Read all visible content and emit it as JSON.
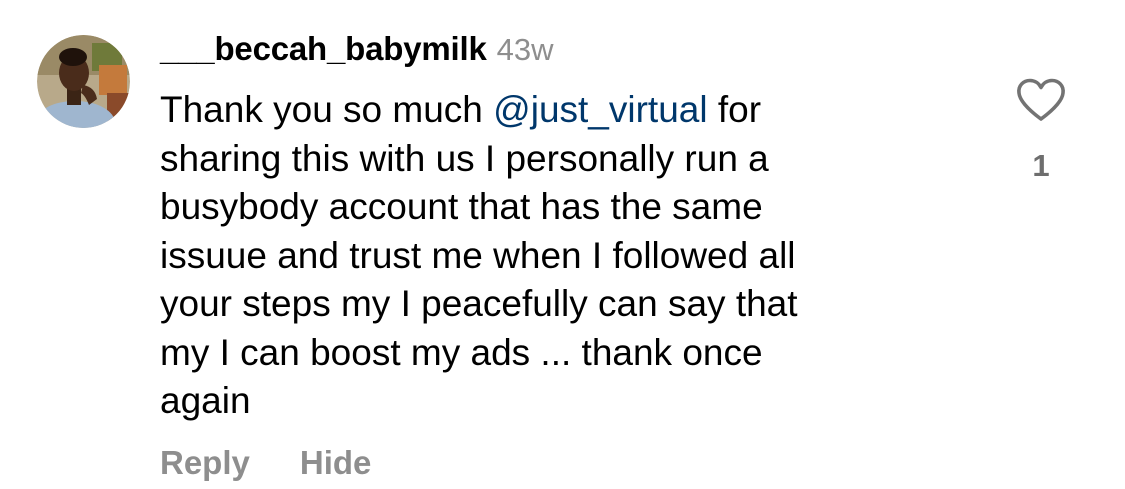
{
  "comment": {
    "username": "___beccah_babymilk",
    "timestamp": "43w",
    "text_before_mention": "Thank you so much ",
    "mention": "@just_virtual",
    "text_after_mention": " for\nsharing this with us I personally  run a\nbusybody account that has the same\nissuue and trust me when I followed all\nyour steps my I peacefully can say that\nmy I can boost my ads ... thank once\nagain",
    "like_count": "1",
    "actions": {
      "reply_label": "Reply",
      "hide_label": "Hide"
    }
  },
  "icons": {
    "avatar": "user-avatar-photo",
    "like": "heart-outline-icon"
  },
  "colors": {
    "mention": "#00376b",
    "muted": "#8e8e8e",
    "text": "#000000",
    "background": "#ffffff"
  }
}
